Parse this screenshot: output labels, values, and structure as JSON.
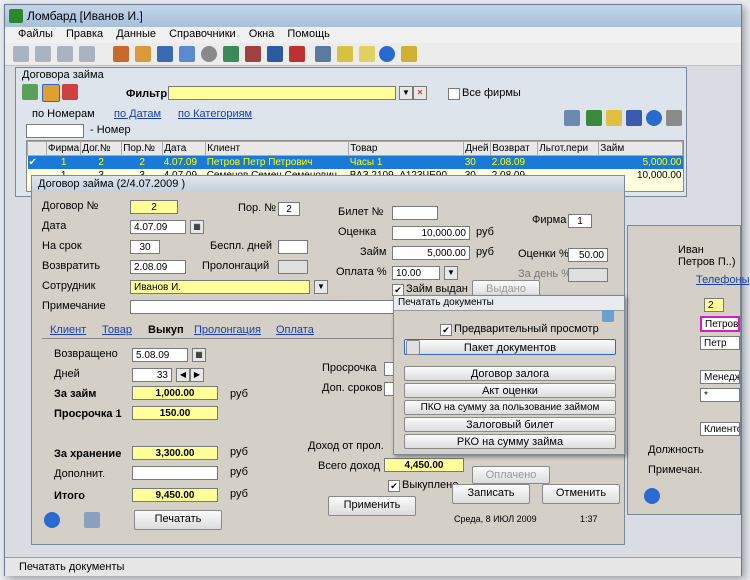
{
  "main_window": {
    "title": "Ломбард [Иванов И.]"
  },
  "menu": [
    "Файлы",
    "Правка",
    "Данные",
    "Справочники",
    "Окна",
    "Помощь"
  ],
  "contracts_window": {
    "title": "Договора займа",
    "filter_label": "Фильтр",
    "all_firms_label": "Все фирмы",
    "tabs": [
      "по Номерам",
      "по Датам",
      "по Категориям"
    ],
    "number_label": "- Номер",
    "columns": [
      "Фирма",
      "Дог.№",
      "Пор.№",
      "Дата",
      "Клиент",
      "Товар",
      "Дней",
      "Возврат",
      "Льгот.пери",
      "Займ"
    ],
    "rows": [
      [
        "1",
        "2",
        "2",
        "4.07.09",
        "Петров Петр Петрович",
        "Часы 1",
        "30",
        "2.08.09",
        "",
        "5,000.00"
      ],
      [
        "1",
        "3",
        "3",
        "4.07.09",
        "Семенов Семен Семенович",
        "ВАЗ 2109, А123ЧЕ90",
        "30",
        "2.08.09",
        "",
        "10,000.00"
      ]
    ]
  },
  "right_panel": {
    "items": [
      "Иван",
      "Петров П..)",
      "Телефоны",
      "2",
      "Петров",
      "Петр",
      "Менеджер",
      "*",
      "Клиентск",
      "Должность",
      "Примечан."
    ]
  },
  "dialog": {
    "title": "Договор займа  (2/4.07.2009 )",
    "labels": {
      "contract_no": "Договор №",
      "date": "Дата",
      "term": "На срок",
      "return": "Возвратить",
      "employee": "Сотрудник",
      "note": "Примечание",
      "ord_no": "Пор. №",
      "free_days": "Беспл. дней",
      "prolongations": "Пролонгаций",
      "ticket_no": "Билет №",
      "estimate": "Оценка",
      "loan": "Займ",
      "payment_pct": "Оплата %",
      "firm": "Фирма",
      "interest_pct": "Оценки %",
      "per_day_pct": "За день %",
      "rub": "руб",
      "loan_issued": "Займ выдан",
      "issued_btn": "Выдано"
    },
    "values": {
      "contract_no": "2",
      "date": "4.07.09",
      "term": "30",
      "return": "2.08.09",
      "employee": "Иванов И.",
      "ord_no": "2",
      "estimate": "10,000.00",
      "loan": "5,000.00",
      "payment_pct": "10.00",
      "firm": "1",
      "interest_pct": "50.00"
    },
    "tabs": [
      "Клиент",
      "Товар",
      "Выкуп",
      "Пролонгация",
      "Оплата"
    ],
    "redeem": {
      "returned_label": "Возвращено",
      "returned": "5.08.09",
      "days_label": "Дней",
      "days": "33",
      "for_loan_label": "За займ",
      "for_loan": "1,000.00",
      "overdue1_label": "Просрочка 1",
      "overdue1": "150.00",
      "storage_label": "За хранение",
      "storage": "3,300.00",
      "extra_label": "Дополнит.",
      "total_label": "Итого",
      "total": "9,450.00",
      "overdue_label": "Просрочка",
      "extra_terms_label": "Доп. сроков",
      "income_prol_label": "Доход от прол.",
      "total_income_label": "Всего доход",
      "total_income": "4,450.00",
      "redeemed_label": "Выкуплено",
      "paid_btn": "Оплачено",
      "rub": "руб"
    },
    "buttons": {
      "print": "Печатать",
      "apply": "Применить",
      "save": "Записать",
      "cancel": "Отменить"
    },
    "status": {
      "db": "Среда, 8 ИЮЛ 2009",
      "time": "1:37"
    }
  },
  "print_popup": {
    "title": "Печатать документы",
    "preview": "Предварительный просмотр",
    "package": "Пакет документов",
    "docs": [
      "Договор залога",
      "Акт оценки",
      "ПКО на сумму за пользование займом",
      "Залоговый билет",
      "РКО на сумму займа"
    ]
  },
  "statusbar": "Печатать документы"
}
